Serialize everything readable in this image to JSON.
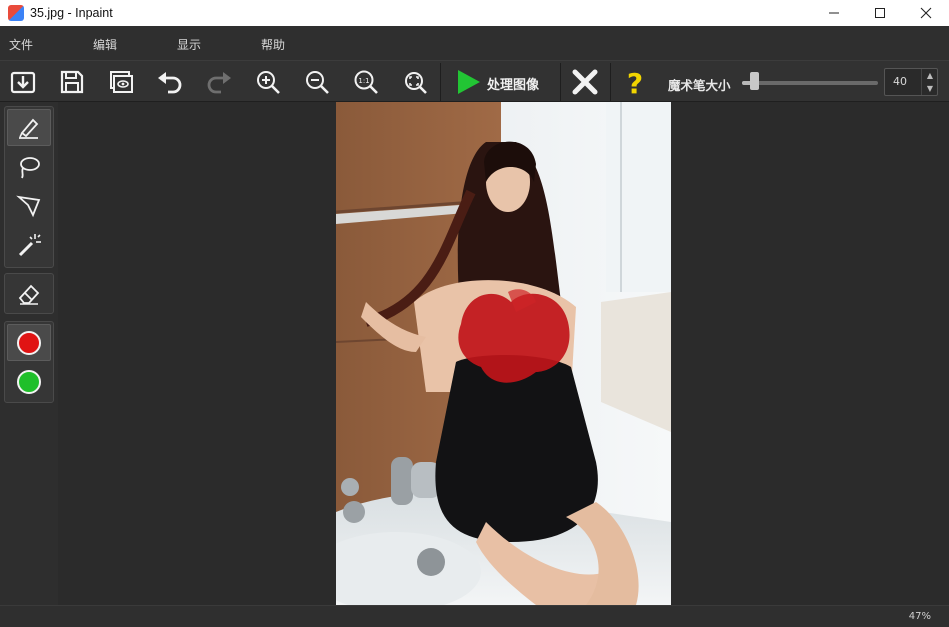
{
  "window": {
    "title": "35.jpg - Inpaint"
  },
  "menu": {
    "items": [
      "文件",
      "编辑",
      "显示",
      "帮助"
    ]
  },
  "toolbar": {
    "buttons": [
      "open-icon",
      "save-icon",
      "preview-icon",
      "undo-icon",
      "redo-icon",
      "zoom-in-icon",
      "zoom-out-icon",
      "zoom-actual-icon",
      "zoom-fit-icon"
    ],
    "process_label": "处理图像",
    "brush_size_label": "魔术笔大小",
    "brush_size_value": "40",
    "brush_size_fraction": 0.06,
    "accent_green": "#22c534",
    "accent_yellow": "#f2d500"
  },
  "tools": {
    "selection": [
      "marker-icon",
      "lasso-icon",
      "polygon-lasso-icon",
      "magic-wand-icon"
    ],
    "eraser": "eraser-icon",
    "colors": [
      {
        "name": "red",
        "hex": "#e01414"
      },
      {
        "name": "green",
        "hex": "#1fbf2a"
      }
    ]
  },
  "status": {
    "zoom": "47%"
  }
}
